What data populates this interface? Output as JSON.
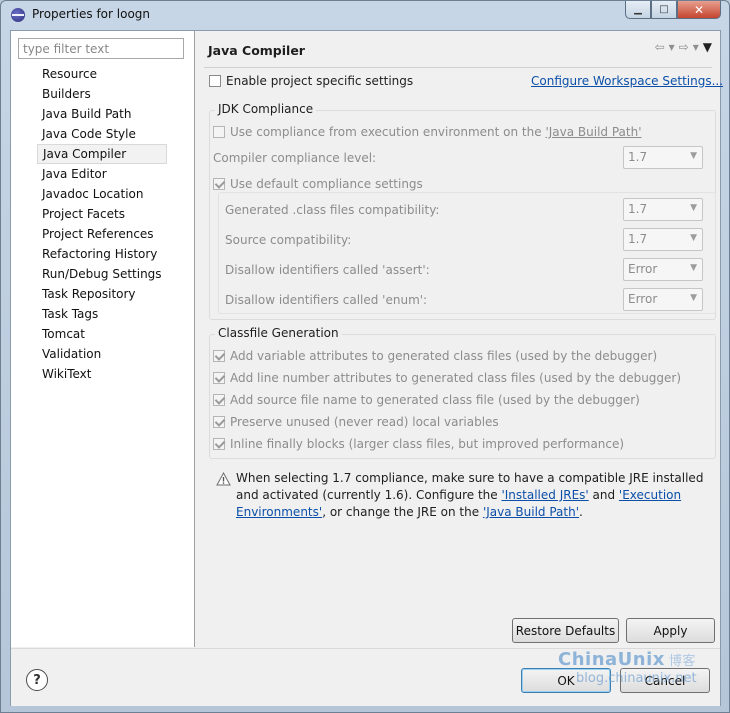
{
  "window": {
    "title": "Properties for loogn",
    "min_glyph": "▁",
    "max_glyph": "□",
    "close_glyph": "✕"
  },
  "filter": {
    "placeholder": "type filter text"
  },
  "nav": {
    "items": [
      "Resource",
      "Builders",
      "Java Build Path",
      "Java Code Style",
      "Java Compiler",
      "Java Editor",
      "Javadoc Location",
      "Project Facets",
      "Project References",
      "Refactoring History",
      "Run/Debug Settings",
      "Task Repository",
      "Task Tags",
      "Tomcat",
      "Validation",
      "WikiText"
    ],
    "selected": "Java Compiler"
  },
  "page": {
    "title": "Java Compiler",
    "back_glyph": "⇦",
    "forward_glyph": "⇨",
    "dropdown_glyph": "▾",
    "menu_glyph": "▼",
    "enable_specific": "Enable project specific settings",
    "configure_link": "Configure Workspace Settings..."
  },
  "jdk": {
    "group_label": "JDK Compliance",
    "use_compliance_prefix": "Use compliance from execution environment on the ",
    "use_compliance_link": "'Java Build Path'",
    "compliance_level_label": "Compiler compliance level:",
    "compliance_level_value": "1.7",
    "use_default": "Use default compliance settings",
    "generated_label": "Generated .class files compatibility:",
    "generated_value": "1.7",
    "source_label": "Source compatibility:",
    "source_value": "1.7",
    "assert_label": "Disallow identifiers called 'assert':",
    "assert_value": "Error",
    "enum_label": "Disallow identifiers called 'enum':",
    "enum_value": "Error"
  },
  "classfile": {
    "group_label": "Classfile Generation",
    "options": [
      "Add variable attributes to generated class files (used by the debugger)",
      "Add line number attributes to generated class files (used by the debugger)",
      "Add source file name to generated class file (used by the debugger)",
      "Preserve unused (never read) local variables",
      "Inline finally blocks (larger class files, but improved performance)"
    ]
  },
  "warning": {
    "text1": "When selecting 1.7 compliance, make sure to have a compatible JRE installed and activated (currently 1.6). Configure the ",
    "link1": "'Installed JREs'",
    "text2": " and ",
    "link2": "'Execution Environments'",
    "text3": ", or change the JRE on the ",
    "link3": "'Java Build Path'",
    "text4": "."
  },
  "buttons": {
    "restore": "Restore Defaults",
    "apply": "Apply",
    "ok": "OK",
    "cancel": "Cancel",
    "help": "?"
  },
  "watermark": {
    "brand": "ChinaUnix",
    "cn": "博客",
    "url": "blog.chinaunix.net"
  }
}
